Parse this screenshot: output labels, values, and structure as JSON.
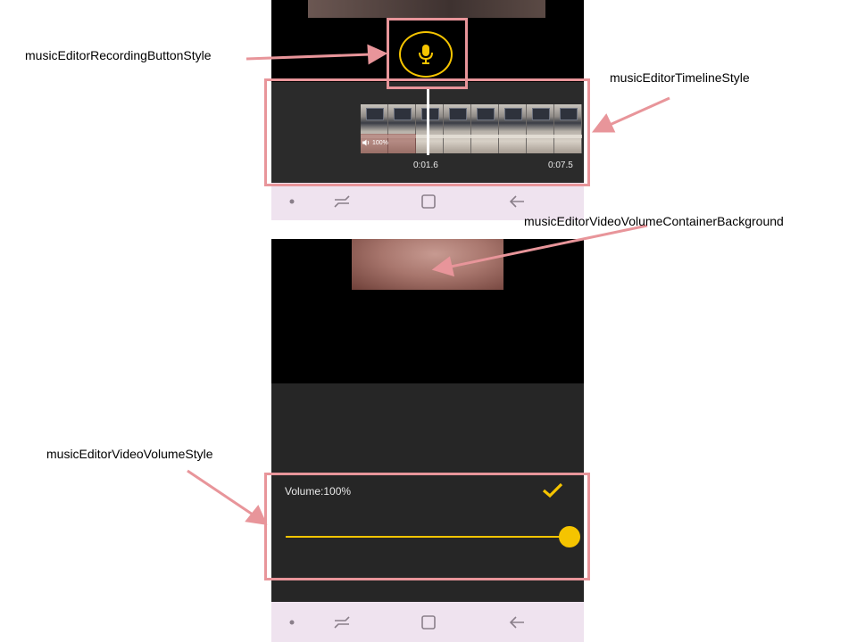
{
  "annotations": {
    "recording_button": "musicEditorRecordingButtonStyle",
    "timeline": "musicEditorTimelineStyle",
    "video_volume_container_background": "musicEditorVideoVolumeContainerBackground",
    "video_volume": "musicEditorVideoVolumeStyle"
  },
  "timeline": {
    "clip_volume_badge": "100%",
    "current_time": "0:01.6",
    "total_time": "0:07.5",
    "thumbnail_count": 8
  },
  "volume_panel": {
    "label": "Volume:100%",
    "value_percent": 100,
    "confirm_icon": "check-icon"
  },
  "icons": {
    "record": "microphone-icon",
    "speaker": "speaker-icon",
    "nav": [
      "dot-icon",
      "recent-apps-icon",
      "home-icon",
      "back-icon"
    ]
  },
  "colors": {
    "accent": "#f5c400",
    "highlight": "#e8959a",
    "panel": "#262626",
    "navbar": "#efe3ef"
  }
}
